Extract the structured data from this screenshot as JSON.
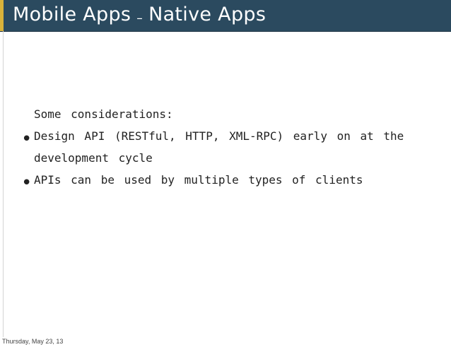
{
  "slide": {
    "title_main": "Mobile Apps",
    "title_separator": "–",
    "title_sub": "Native Apps",
    "intro": "Some considerations:",
    "bullets": [
      {
        "text": "Design API (RESTful, HTTP, XML-RPC) early on at the development cycle"
      },
      {
        "text": "APIs can be used by multiple types of clients"
      }
    ],
    "bullet_glyph": "•"
  },
  "footer": {
    "date": "Thursday, May 23, 13"
  },
  "colors": {
    "title_bar": "#2b4a5f",
    "title_accent": "#d9b23a",
    "title_text": "#ffffff",
    "body_text": "#222222"
  }
}
